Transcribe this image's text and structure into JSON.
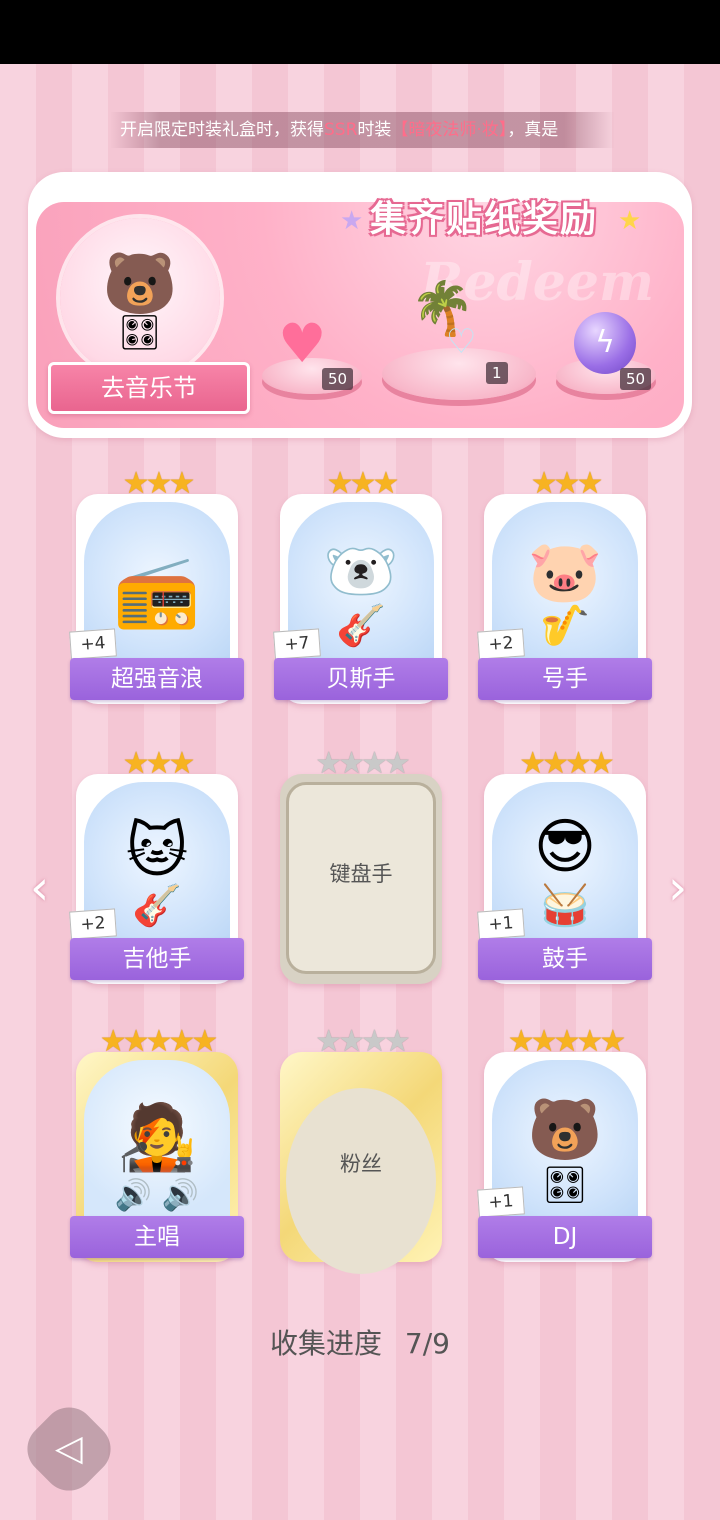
{
  "marquee": {
    "prefix": "开启限定时装礼盒时，获得",
    "ssr": "SSR",
    "middle": "时装",
    "item": "【暗夜法师·妆】",
    "suffix": "，真是"
  },
  "banner": {
    "title": "集齐贴纸奖励",
    "watermark": "Redeem",
    "music_button": "去音乐节",
    "rewards": [
      {
        "name": "pink-heart-gem",
        "count": "50"
      },
      {
        "name": "island-scene",
        "count": "1"
      },
      {
        "name": "purple-orb",
        "count": "50"
      }
    ]
  },
  "cards": [
    {
      "name": "超强音浪",
      "stars": 3,
      "plus": "+4",
      "owned": true,
      "icon": "boombox"
    },
    {
      "name": "贝斯手",
      "stars": 3,
      "plus": "+7",
      "owned": true,
      "icon": "bear-bass"
    },
    {
      "name": "号手",
      "stars": 3,
      "plus": "+2",
      "owned": true,
      "icon": "pig-sax"
    },
    {
      "name": "吉他手",
      "stars": 3,
      "plus": "+2",
      "owned": true,
      "icon": "cat-guitar"
    },
    {
      "name": "键盘手",
      "stars": 4,
      "plus": "",
      "owned": false,
      "icon": "locked"
    },
    {
      "name": "鼓手",
      "stars": 4,
      "plus": "+1",
      "owned": true,
      "icon": "dog-drums"
    },
    {
      "name": "主唱",
      "stars": 5,
      "plus": "",
      "owned": true,
      "icon": "singer"
    },
    {
      "name": "粉丝",
      "stars": 4,
      "plus": "",
      "owned": false,
      "icon": "locked"
    },
    {
      "name": "DJ",
      "stars": 5,
      "plus": "+1",
      "owned": true,
      "icon": "bear-dj"
    }
  ],
  "progress": {
    "label": "收集进度",
    "value": "7/9",
    "collected": 7,
    "total": 9
  },
  "colors": {
    "accent_pink": "#f784a8",
    "label_purple": "#9a63dc",
    "star_gold": "#f7b321"
  }
}
